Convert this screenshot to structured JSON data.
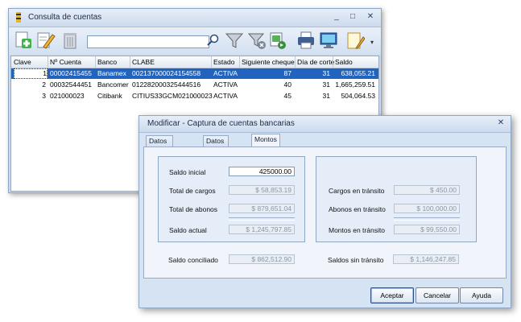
{
  "main_window": {
    "title": "Consulta de cuentas",
    "controls": {
      "minimize": "_",
      "maximize": "□",
      "close": "✕"
    },
    "toolbar": {
      "search_value": "",
      "icons": [
        "new-account-icon",
        "edit-icon",
        "delete-icon",
        "search-icon",
        "filter-icon",
        "clear-filter-icon",
        "export-icon",
        "print-icon",
        "screen-icon",
        "document-icon",
        "overflow-icon"
      ]
    },
    "grid": {
      "columns": [
        "Clave",
        "Nº Cuenta",
        "Banco",
        "CLABE",
        "Estado",
        "Siguiente cheque",
        "Día de corte",
        "Saldo"
      ],
      "rows": [
        {
          "clave": "1",
          "cuenta": "00002415455",
          "banco": "Banamex",
          "clabe": "002137000024154558",
          "estado": "ACTIVA",
          "cheque": "87",
          "corte": "31",
          "saldo": "638,055.21"
        },
        {
          "clave": "2",
          "cuenta": "00032544451",
          "banco": "Bancomer",
          "clabe": "012282000325444516",
          "estado": "ACTIVA",
          "cheque": "40",
          "corte": "31",
          "saldo": "1,665,259.51"
        },
        {
          "clave": "3",
          "cuenta": "021000023",
          "banco": "Citibank",
          "clabe": "CITIUS33GCM021000023",
          "estado": "ACTIVA",
          "cheque": "45",
          "corte": "31",
          "saldo": "504,064.53"
        }
      ]
    }
  },
  "dialog": {
    "title": "Modificar - Captura de cuentas bancarias",
    "close": "✕",
    "tabs": [
      "Datos de la cuenta",
      "Datos del Banco",
      "Montos"
    ],
    "left": {
      "saldo_inicial": {
        "label": "Saldo inicial",
        "value": "425000.00"
      },
      "total_cargos": {
        "label": "Total de cargos",
        "value": "$ 58,853.19"
      },
      "total_abonos": {
        "label": "Total de abonos",
        "value": "$ 879,651.04"
      },
      "saldo_actual": {
        "label": "Saldo actual",
        "value": "$ 1,245,797.85"
      }
    },
    "right": {
      "cargos_transito": {
        "label": "Cargos en tránsito",
        "value": "$ 450.00"
      },
      "abonos_transito": {
        "label": "Abonos en tránsito",
        "value": "$ 100,000.00"
      },
      "montos_transito": {
        "label": "Montos en tránsito",
        "value": "$ 99,550.00"
      }
    },
    "saldo_conciliado": {
      "label": "Saldo conciliado",
      "value": "$ 862,512.90"
    },
    "saldos_sin_transito": {
      "label": "Saldos sin tránsito",
      "value": "$ 1,146,247.85"
    },
    "buttons": {
      "accept": "Aceptar",
      "cancel": "Cancelar",
      "help": "Ayuda"
    }
  }
}
